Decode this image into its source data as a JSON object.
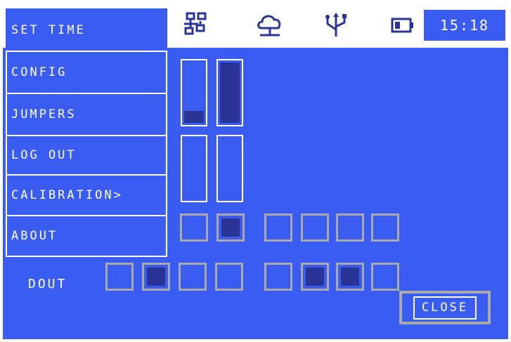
{
  "status_bar": {
    "time": "15:18",
    "icons": [
      "network-icon",
      "cloud-icon",
      "usb-icon",
      "battery-icon"
    ]
  },
  "menu": {
    "items": [
      {
        "label": "Set time"
      },
      {
        "label": "Config"
      },
      {
        "label": "Jumpers"
      },
      {
        "label": "Log out"
      },
      {
        "label": "Calibration>"
      },
      {
        "label": "About"
      }
    ]
  },
  "analog_bars": {
    "top_row_levels": [
      0.2,
      1.0
    ],
    "bottom_row_levels": [
      0.0,
      0.0
    ]
  },
  "din_states": [
    false,
    true,
    false,
    false,
    false,
    false
  ],
  "dout": {
    "label": "Dout",
    "states": [
      false,
      true,
      false,
      false,
      false,
      true,
      true,
      false
    ]
  },
  "close_button": {
    "label": "Close"
  },
  "colors": {
    "screen_background": "#3a5cf0",
    "indicator_on": "#2a3494",
    "cell_border": "#aaaaaa",
    "status_bar_background": "#ffffff"
  }
}
